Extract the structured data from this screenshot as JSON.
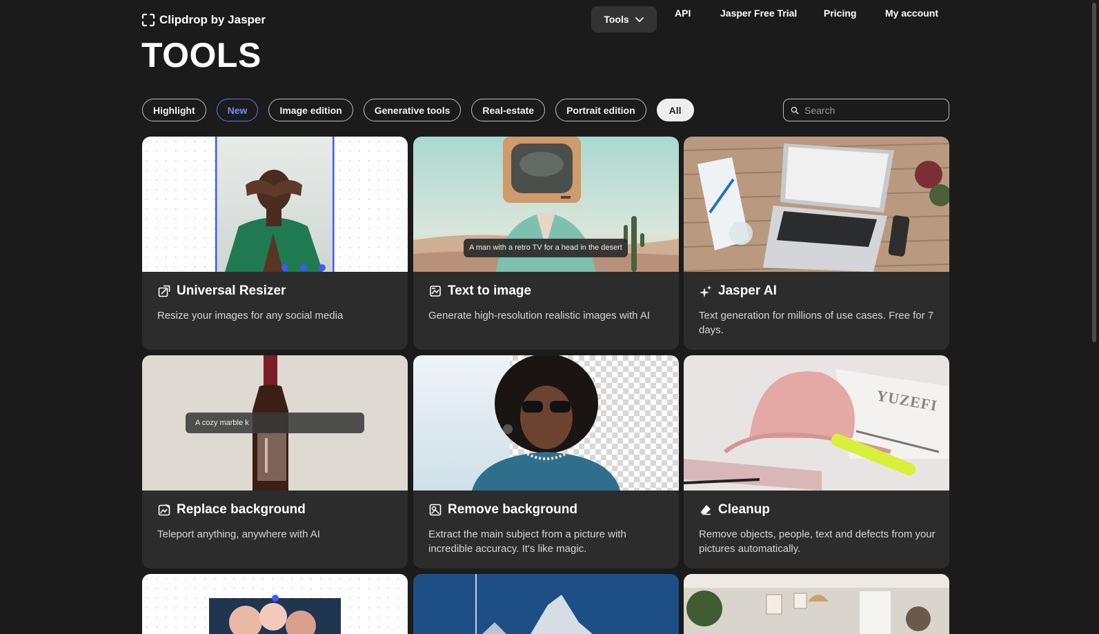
{
  "header": {
    "logo_text": "Clipdrop by Jasper",
    "nav": {
      "tools_label": "Tools",
      "api_label": "API",
      "trial_label": "Jasper Free Trial",
      "pricing_label": "Pricing",
      "account_label": "My account"
    }
  },
  "page_title": "TOOLS",
  "filters": [
    "Highlight",
    "New",
    "Image edition",
    "Generative tools",
    "Real-estate",
    "Portrait edition",
    "All"
  ],
  "search": {
    "placeholder": "Search",
    "value": ""
  },
  "cards": [
    {
      "title": "Universal Resizer",
      "description": "Resize your images for any social media",
      "icon": "resize-icon"
    },
    {
      "title": "Text to image",
      "description": "Generate high-resolution realistic images with AI",
      "icon": "text-to-image-icon",
      "overlay": "A man with a retro TV for a head in the desert"
    },
    {
      "title": "Jasper AI",
      "description": "Text generation for millions of use cases. Free for 7 days.",
      "icon": "sparkle-icon"
    },
    {
      "title": "Replace background",
      "description": "Teleport anything, anywhere with AI",
      "icon": "replace-background-icon",
      "overlay": "A cozy marble k"
    },
    {
      "title": "Remove background",
      "description": "Extract the main subject from a picture with incredible accuracy. It's like magic.",
      "icon": "remove-background-icon"
    },
    {
      "title": "Cleanup",
      "description": "Remove objects, people, text and defects from your pictures automatically.",
      "icon": "eraser-icon",
      "thumb_text": "YUZEFI"
    }
  ],
  "colors": {
    "background": "#1b1b1b",
    "card": "#2c2c2c",
    "accent": "#5a78ff"
  }
}
